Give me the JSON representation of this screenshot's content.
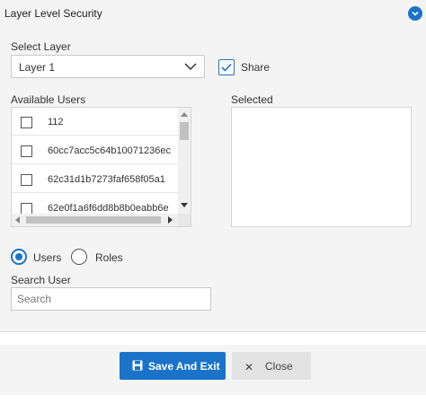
{
  "panel": {
    "title": "Layer Level Security"
  },
  "layer": {
    "label": "Select Layer",
    "value": "Layer 1"
  },
  "share": {
    "label": "Share",
    "checked": true
  },
  "available": {
    "label": "Available Users",
    "users": [
      "112",
      "60cc7acc5c64b10071236ec",
      "62c31d1b7273faf658f05a1",
      "62e0f1a6f6dd8b8b0eabb6e"
    ]
  },
  "selected": {
    "label": "Selected"
  },
  "mode": {
    "users_label": "Users",
    "roles_label": "Roles",
    "selected": "Users"
  },
  "search": {
    "label": "Search User",
    "placeholder": "Search",
    "value": ""
  },
  "footer": {
    "save_label": "Save And Exit",
    "close_label": "Close"
  },
  "colors": {
    "accent": "#1a73c9",
    "panel_bg": "#f4f4f4"
  }
}
